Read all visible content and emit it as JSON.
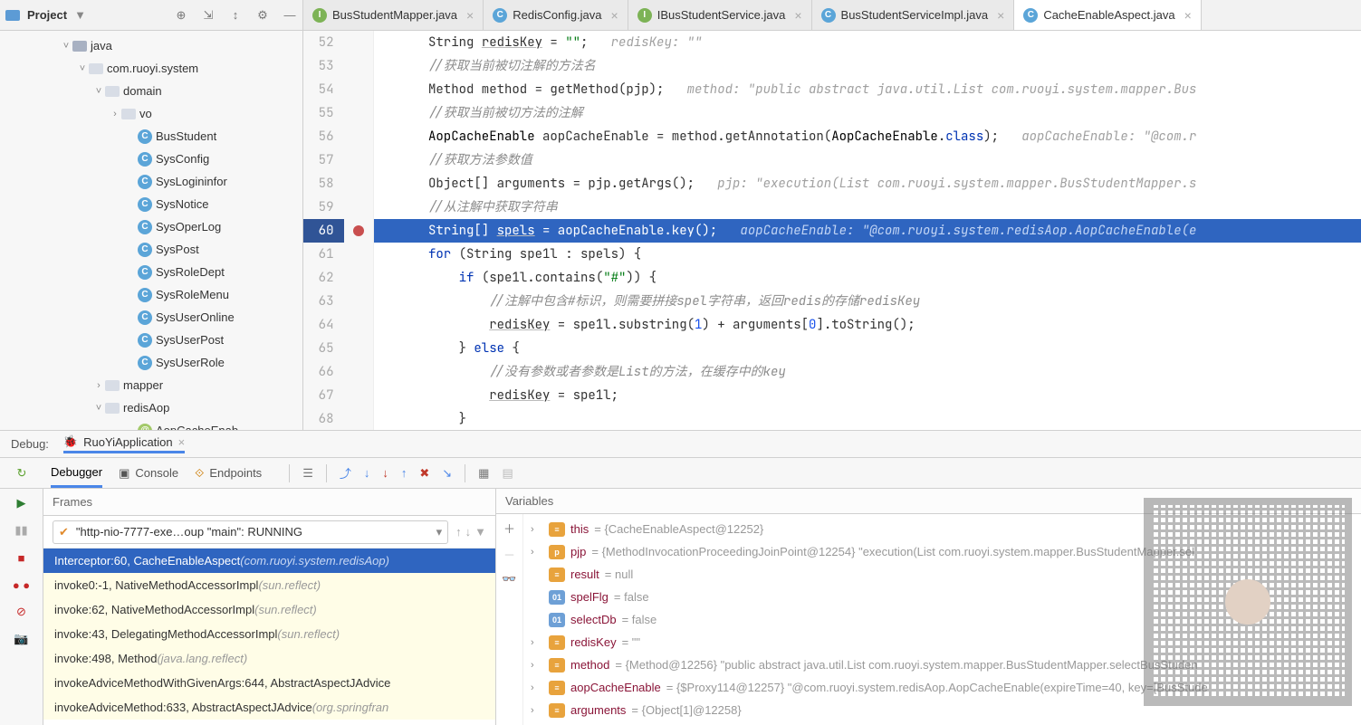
{
  "project": {
    "title": "Project",
    "tree": [
      {
        "depth": 3,
        "exp": "v",
        "icon": "folder",
        "label": "java"
      },
      {
        "depth": 4,
        "exp": "v",
        "icon": "folder2",
        "label": "com.ruoyi.system"
      },
      {
        "depth": 5,
        "exp": "v",
        "icon": "folder2",
        "label": "domain"
      },
      {
        "depth": 6,
        "exp": ">",
        "icon": "folder2",
        "label": "vo"
      },
      {
        "depth": 7,
        "exp": "",
        "icon": "class",
        "label": "BusStudent"
      },
      {
        "depth": 7,
        "exp": "",
        "icon": "class",
        "label": "SysConfig"
      },
      {
        "depth": 7,
        "exp": "",
        "icon": "class",
        "label": "SysLogininfor"
      },
      {
        "depth": 7,
        "exp": "",
        "icon": "class",
        "label": "SysNotice"
      },
      {
        "depth": 7,
        "exp": "",
        "icon": "class",
        "label": "SysOperLog"
      },
      {
        "depth": 7,
        "exp": "",
        "icon": "class",
        "label": "SysPost"
      },
      {
        "depth": 7,
        "exp": "",
        "icon": "class",
        "label": "SysRoleDept"
      },
      {
        "depth": 7,
        "exp": "",
        "icon": "class",
        "label": "SysRoleMenu"
      },
      {
        "depth": 7,
        "exp": "",
        "icon": "class",
        "label": "SysUserOnline"
      },
      {
        "depth": 7,
        "exp": "",
        "icon": "class",
        "label": "SysUserPost"
      },
      {
        "depth": 7,
        "exp": "",
        "icon": "class",
        "label": "SysUserRole"
      },
      {
        "depth": 5,
        "exp": ">",
        "icon": "folder2",
        "label": "mapper"
      },
      {
        "depth": 5,
        "exp": "v",
        "icon": "folder2",
        "label": "redisAop"
      },
      {
        "depth": 7,
        "exp": "",
        "icon": "ann",
        "label": "AopCacheEnab"
      }
    ]
  },
  "tabs": [
    {
      "icon": "iface",
      "label": "BusStudentMapper.java",
      "active": false
    },
    {
      "icon": "class",
      "label": "RedisConfig.java",
      "active": false
    },
    {
      "icon": "iface",
      "label": "IBusStudentService.java",
      "active": false
    },
    {
      "icon": "class",
      "label": "BusStudentServiceImpl.java",
      "active": false
    },
    {
      "icon": "class",
      "label": "CacheEnableAspect.java",
      "active": true
    }
  ],
  "lines": [
    {
      "n": 52,
      "html": "String <span class='under'>redisKey</span> = <span class='str'>\"\"</span>;   <span class='hint'>redisKey: \"\"</span>"
    },
    {
      "n": 53,
      "html": "<span class='cm'>//获取当前被切注解的方法名</span>"
    },
    {
      "n": 54,
      "html": "Method method = getMethod(pjp);   <span class='hint'>method: \"public abstract java.util.List com.ruoyi.system.mapper.Bus</span>"
    },
    {
      "n": 55,
      "html": "<span class='cm'>//获取当前被切方法的注解</span>"
    },
    {
      "n": 56,
      "html": "<span class='ty'>AopCacheEnable</span> aopCacheEnable = method.getAnnotation(<span class='ty'>AopCacheEnable</span>.<span class='kw'>class</span>);   <span class='hint'>aopCacheEnable: \"@com.r</span>"
    },
    {
      "n": 57,
      "html": "<span class='cm'>//获取方法参数值</span>"
    },
    {
      "n": 58,
      "html": "Object[] arguments = pjp.getArgs();   <span class='hint'>pjp: \"execution(List com.ruoyi.system.mapper.BusStudentMapper.s</span>"
    },
    {
      "n": 59,
      "html": "<span class='cm'>//从注解中获取字符串</span>"
    },
    {
      "n": 60,
      "bp": true,
      "html": "String[] <span class='under'>spels</span> = aopCacheEnable.key();   <span class='hint'>aopCacheEnable: \"@com.ruoyi.system.redisAop.AopCacheEnable(e</span>"
    },
    {
      "n": 61,
      "html": "<span class='kw'>for</span> (String spe1l : spels) {"
    },
    {
      "n": 62,
      "html": "    <span class='kw'>if</span> (spe1l.contains(<span class='str'>\"#\"</span>)) {"
    },
    {
      "n": 63,
      "html": "        <span class='cm'>//注解中包含#标识，则需要拼接spel字符串，返回redis的存储redisKey</span>"
    },
    {
      "n": 64,
      "html": "        <span class='under'>redisKey</span> = spe1l.substring(<span class='num'>1</span>) + arguments[<span class='num'>0</span>].toString();"
    },
    {
      "n": 65,
      "html": "    } <span class='kw'>else</span> {"
    },
    {
      "n": 66,
      "html": "        <span class='cm'>//没有参数或者参数是List的方法，在缓存中的key</span>"
    },
    {
      "n": 67,
      "html": "        <span class='under'>redisKey</span> = spe1l;"
    },
    {
      "n": 68,
      "html": "    }"
    }
  ],
  "debug": {
    "label": "Debug:",
    "config": "RuoYiApplication",
    "tabs": {
      "debugger": "Debugger",
      "console": "Console",
      "endpoints": "Endpoints"
    },
    "framesTitle": "Frames",
    "variablesTitle": "Variables",
    "thread": "\"http-nio-7777-exe…oup \"main\": RUNNING",
    "frames": [
      {
        "sel": true,
        "lib": false,
        "txt": "Interceptor:60, CacheEnableAspect ",
        "loc": "(com.ruoyi.system.redisAop)"
      },
      {
        "sel": false,
        "lib": true,
        "txt": "invoke0:-1, NativeMethodAccessorImpl ",
        "loc": "(sun.reflect)"
      },
      {
        "sel": false,
        "lib": true,
        "txt": "invoke:62, NativeMethodAccessorImpl ",
        "loc": "(sun.reflect)"
      },
      {
        "sel": false,
        "lib": true,
        "txt": "invoke:43, DelegatingMethodAccessorImpl ",
        "loc": "(sun.reflect)"
      },
      {
        "sel": false,
        "lib": true,
        "txt": "invoke:498, Method ",
        "loc": "(java.lang.reflect)"
      },
      {
        "sel": false,
        "lib": true,
        "txt": "invokeAdviceMethodWithGivenArgs:644, AbstractAspectJAdvice ",
        "loc": ""
      },
      {
        "sel": false,
        "lib": true,
        "txt": "invokeAdviceMethod:633, AbstractAspectJAdvice ",
        "loc": "(org.springfran"
      }
    ],
    "vars": [
      {
        "exp": ">",
        "icon": "obj",
        "name": "this",
        "rest": " = {CacheEnableAspect@12252}"
      },
      {
        "exp": ">",
        "icon": "prm",
        "name": "pjp",
        "rest": " = {MethodInvocationProceedingJoinPoint@12254} \"execution(List com.ruoyi.system.mapper.BusStudentMapper.sel"
      },
      {
        "exp": "",
        "icon": "obj",
        "name": "result",
        "rest": " = null"
      },
      {
        "exp": "",
        "icon": "bool",
        "name": "spelFlg",
        "rest": " = false"
      },
      {
        "exp": "",
        "icon": "bool",
        "name": "selectDb",
        "rest": " = false"
      },
      {
        "exp": ">",
        "icon": "obj",
        "name": "redisKey",
        "rest": " = \"\""
      },
      {
        "exp": ">",
        "icon": "obj",
        "name": "method",
        "rest": " = {Method@12256} \"public abstract java.util.List com.ruoyi.system.mapper.BusStudentMapper.selectBusStuden"
      },
      {
        "exp": ">",
        "icon": "obj",
        "name": "aopCacheEnable",
        "rest": " = {$Proxy114@12257} \"@com.ruoyi.system.redisAop.AopCacheEnable(expireTime=40, key=[BusStude"
      },
      {
        "exp": ">",
        "icon": "obj",
        "name": "arguments",
        "rest": " = {Object[1]@12258}"
      }
    ]
  }
}
